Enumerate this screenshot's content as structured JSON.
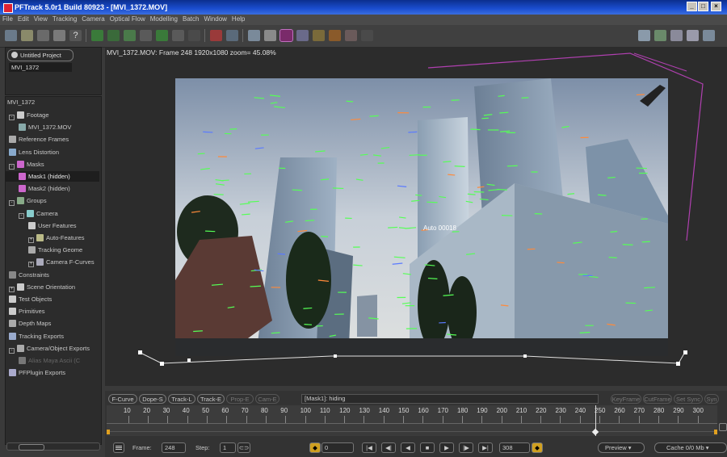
{
  "window": {
    "title": "PFTrack 5.0r1 Build 80923 - [MVI_1372.MOV]",
    "controls": [
      "_",
      "□",
      "×"
    ]
  },
  "menu": [
    "File",
    "Edit",
    "View",
    "Tracking",
    "Camera",
    "Optical Flow",
    "Modelling",
    "Batch",
    "Window",
    "Help"
  ],
  "project": {
    "name": "Untitled Project",
    "clip": "MVI_1372"
  },
  "tree": {
    "header": "MVI_1372",
    "items": [
      {
        "label": "Footage",
        "indent": 0,
        "icon": "footage-icon",
        "expander": "-"
      },
      {
        "label": "MVI_1372.MOV",
        "indent": 1,
        "icon": "clip-icon",
        "expander": ""
      },
      {
        "label": "Reference Frames",
        "indent": 0,
        "icon": "reference-frames-icon",
        "expander": ""
      },
      {
        "label": "Lens Distortion",
        "indent": 0,
        "icon": "lens-icon",
        "expander": ""
      },
      {
        "label": "Masks",
        "indent": 0,
        "icon": "mask-icon",
        "expander": "-"
      },
      {
        "label": "Mask1 (hidden)",
        "indent": 1,
        "icon": "mask-icon",
        "expander": "",
        "selected": true
      },
      {
        "label": "Mask2 (hidden)",
        "indent": 1,
        "icon": "mask-icon",
        "expander": ""
      },
      {
        "label": "Groups",
        "indent": 0,
        "icon": "groups-icon",
        "expander": "-"
      },
      {
        "label": "Camera",
        "indent": 1,
        "icon": "camera-icon",
        "expander": "-"
      },
      {
        "label": "User Features",
        "indent": 2,
        "icon": "user-features-icon",
        "expander": ""
      },
      {
        "label": "Auto-Features",
        "indent": 2,
        "icon": "auto-features-icon",
        "expander": "+"
      },
      {
        "label": "Tracking Geome",
        "indent": 2,
        "icon": "tracking-geometry-icon",
        "expander": ""
      },
      {
        "label": "Camera F-Curves",
        "indent": 2,
        "icon": "camera-fcurves-icon",
        "expander": "+"
      },
      {
        "label": "Constraints",
        "indent": 0,
        "icon": "constraints-icon",
        "expander": ""
      },
      {
        "label": "Scene Orientation",
        "indent": 0,
        "icon": "scene-orientation-icon",
        "expander": "+"
      },
      {
        "label": "Test Objects",
        "indent": 0,
        "icon": "test-objects-icon",
        "expander": ""
      },
      {
        "label": "Primitives",
        "indent": 0,
        "icon": "primitives-icon",
        "expander": ""
      },
      {
        "label": "Depth Maps",
        "indent": 0,
        "icon": "depth-maps-icon",
        "expander": ""
      },
      {
        "label": "Tracking Exports",
        "indent": 0,
        "icon": "tracking-exports-icon",
        "expander": ""
      },
      {
        "label": "Camera/Object Exports",
        "indent": 0,
        "icon": "camera-exports-icon",
        "expander": "-"
      },
      {
        "label": "Alias Maya Ascii (C",
        "indent": 1,
        "icon": "export-file-icon",
        "expander": "",
        "dim": true
      },
      {
        "label": "PFPlugin Exports",
        "indent": 0,
        "icon": "plugin-exports-icon",
        "expander": ""
      }
    ]
  },
  "viewer": {
    "frame_info": "MVI_1372.MOV: Frame 248  1920x1080  zoom= 45.08%",
    "track_label": "Auto 00018"
  },
  "timeline": {
    "buttons": [
      {
        "label": "F-Curve",
        "enabled": true
      },
      {
        "label": "Dope-S",
        "enabled": true
      },
      {
        "label": "Track-L",
        "enabled": true
      },
      {
        "label": "Track-E",
        "enabled": true
      },
      {
        "label": "Prop-E",
        "enabled": false
      },
      {
        "label": "Cam-E",
        "enabled": false
      }
    ],
    "status": "[Mask1]: hiding",
    "right_buttons": [
      "KeyFrame",
      "CutFrame",
      "Set Sync",
      "Syn"
    ],
    "ticks": [
      "10",
      "20",
      "30",
      "40",
      "50",
      "60",
      "70",
      "80",
      "90",
      "100",
      "110",
      "120",
      "130",
      "140",
      "150",
      "160",
      "170",
      "180",
      "190",
      "200",
      "210",
      "220",
      "230",
      "240",
      "250",
      "260",
      "270",
      "280",
      "290",
      "300"
    ],
    "frame_min": 1,
    "frame_max": 308,
    "current_frame": 248
  },
  "playback": {
    "frame_label": "Frame:",
    "frame_value": "248",
    "step_label": "Step:",
    "step_value": "1",
    "start_value": "0",
    "end_value": "308",
    "preview_label": "Preview",
    "cache_label": "Cache 0/0 Mb"
  },
  "colors": {
    "accent": "#b040b0",
    "track_green": "#55ff55",
    "title_blue": "#1b4ed0"
  }
}
